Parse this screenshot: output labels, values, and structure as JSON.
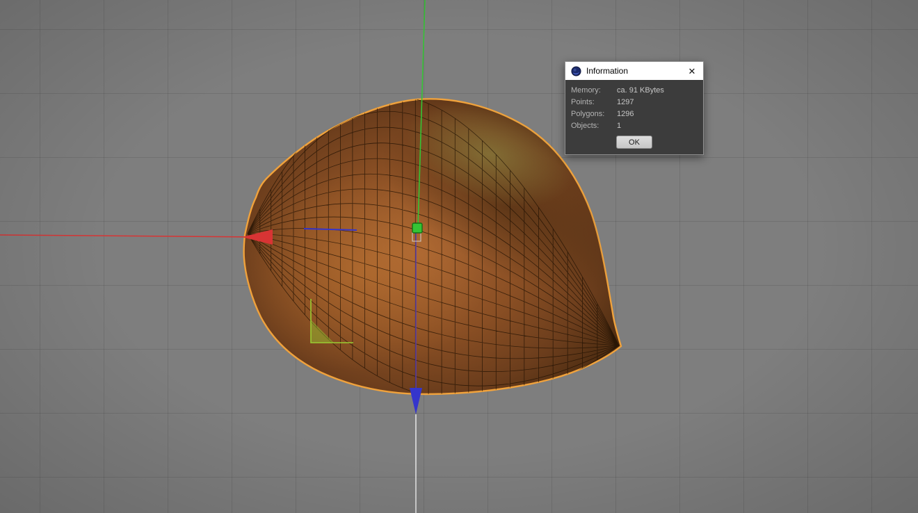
{
  "viewport": {
    "bg_color": "#7e7e7e",
    "grid_color": "#707070",
    "axis_colors": {
      "x": "#d83434",
      "y": "#35c435",
      "z": "#3535cc",
      "shaft": "#5a3fb0",
      "world": "#e9e9e9",
      "scale_gizmo": "#9acd32"
    }
  },
  "model": {
    "selection_color": "#f0a23c",
    "wireframe_color": "#1c0f02",
    "body_center": "#a86432",
    "body_edge": "#47290f"
  },
  "dialog": {
    "title": "Information",
    "close_label": "✕",
    "rows": [
      {
        "label": "Memory:",
        "value": "ca. 91 KBytes"
      },
      {
        "label": "Points:",
        "value": "1297"
      },
      {
        "label": "Polygons:",
        "value": "1296"
      },
      {
        "label": "Objects:",
        "value": "1"
      }
    ],
    "ok_label": "OK"
  }
}
